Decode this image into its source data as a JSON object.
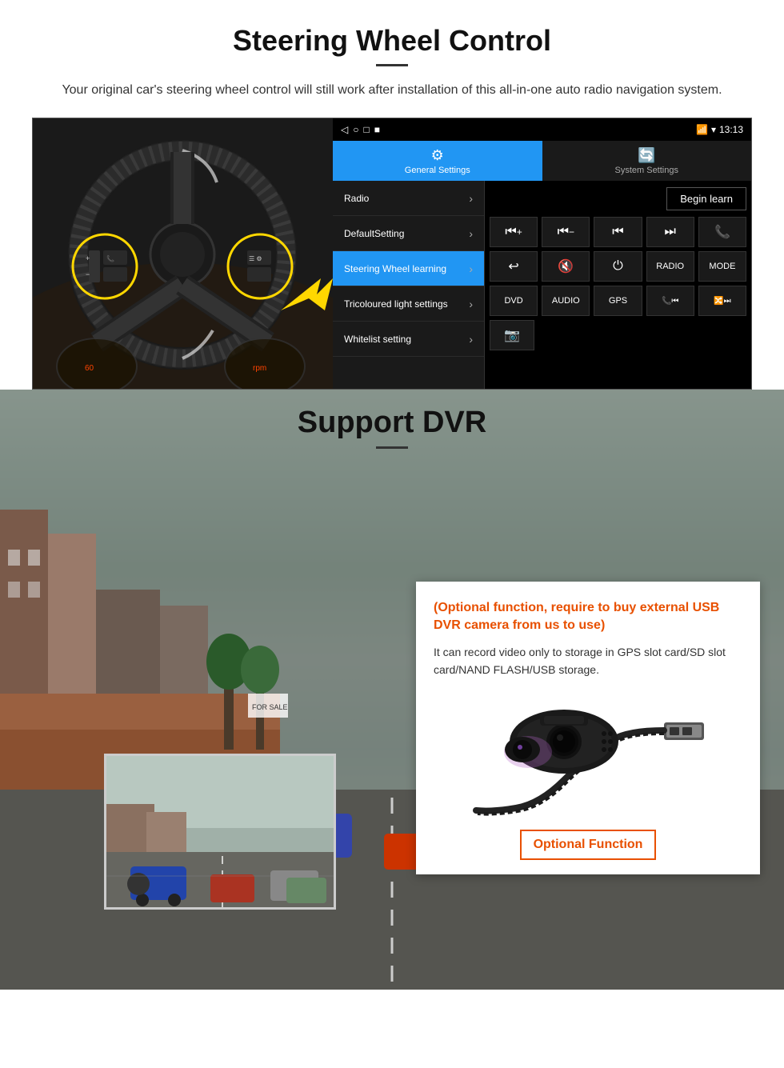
{
  "page": {
    "section1": {
      "title": "Steering Wheel Control",
      "subtitle": "Your original car's steering wheel control will still work after installation of this all-in-one auto radio navigation system.",
      "divider": true
    },
    "android": {
      "statusbar": {
        "time": "13:13",
        "icons": [
          "◁",
          "○",
          "□",
          "■"
        ]
      },
      "tabs": [
        {
          "label": "General Settings",
          "icon": "⚙",
          "active": true
        },
        {
          "label": "System Settings",
          "icon": "🔄",
          "active": false
        }
      ],
      "menu": [
        {
          "label": "Radio",
          "active": false
        },
        {
          "label": "DefaultSetting",
          "active": false
        },
        {
          "label": "Steering Wheel learning",
          "active": true
        },
        {
          "label": "Tricoloured light settings",
          "active": false
        },
        {
          "label": "Whitelist setting",
          "active": false
        }
      ],
      "begin_learn": "Begin learn",
      "controls": [
        [
          "⏮+",
          "⏮-",
          "⏮",
          "⏭",
          "📞"
        ],
        [
          "↩",
          "🔇",
          "⏻",
          "RADIO",
          "MODE"
        ],
        [
          "DVD",
          "AUDIO",
          "GPS",
          "📞⏮",
          "🔀⏭"
        ],
        [
          "📷"
        ]
      ]
    },
    "section2": {
      "title": "Support DVR",
      "divider": true,
      "optional_text": "(Optional function, require to buy external USB DVR camera from us to use)",
      "desc_text": "It can record video only to storage in GPS slot card/SD slot card/NAND FLASH/USB storage.",
      "optional_btn": "Optional Function"
    }
  }
}
